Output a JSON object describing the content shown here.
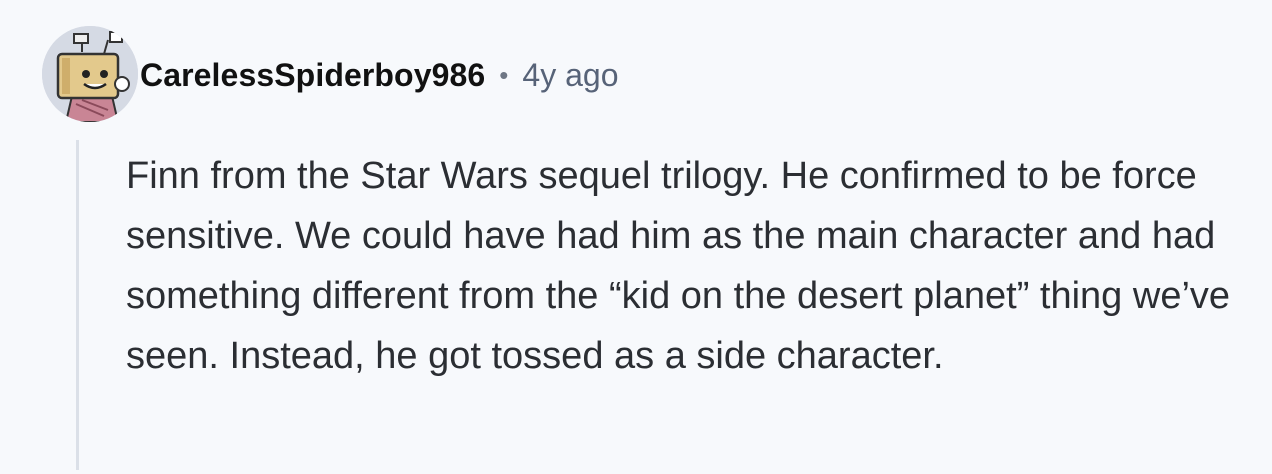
{
  "comment": {
    "avatar_icon": "snoo-avatar-icon",
    "username": "CarelessSpiderboy986",
    "separator": "•",
    "timestamp": "4y ago",
    "body": "Finn from the Star Wars sequel trilogy. He confirmed to be force sensitive. We could have had him as the main character and had something different from the “kid on the desert planet” thing we’ve seen. Instead, he got tossed as a side character."
  },
  "colors": {
    "background": "#f7f9fc",
    "username": "#111111",
    "timestamp": "#576378",
    "thread_line": "#dbe0e8",
    "body_text": "#2b2e33"
  }
}
